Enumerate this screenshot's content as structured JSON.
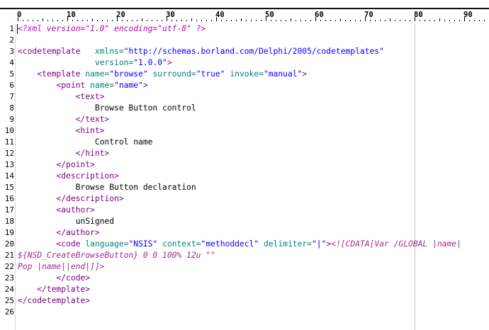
{
  "ruler": {
    "labels": [
      "0",
      "10",
      "20",
      "30",
      "40",
      "50",
      "60",
      "70",
      "80",
      "90"
    ]
  },
  "colors": {
    "tag": "#800080",
    "attribute": "#008080",
    "string": "#0000ff",
    "processing_instruction": "#c000c0",
    "cdata": "#9b308f"
  },
  "editor": {
    "lines": [
      {
        "number": "1",
        "tokens": [
          {
            "k": "pi",
            "t": "<?xml version=\"1.0\" encoding=\"utf-8\" ?>"
          }
        ]
      },
      {
        "number": "2",
        "tokens": []
      },
      {
        "number": "3",
        "tokens": [
          {
            "k": "tag",
            "t": "<codetemplate"
          },
          {
            "k": "txt",
            "t": "   "
          },
          {
            "k": "attr",
            "t": "xmlns="
          },
          {
            "k": "str",
            "t": "\"http://schemas.borland.com/Delphi/2005/codetemplates\""
          }
        ]
      },
      {
        "number": "4",
        "tokens": [
          {
            "k": "txt",
            "t": "                "
          },
          {
            "k": "attr",
            "t": "version="
          },
          {
            "k": "str",
            "t": "\"1.0.0\""
          },
          {
            "k": "tag",
            "t": ">"
          }
        ]
      },
      {
        "number": "5",
        "tokens": [
          {
            "k": "txt",
            "t": "    "
          },
          {
            "k": "tag",
            "t": "<template"
          },
          {
            "k": "txt",
            "t": " "
          },
          {
            "k": "attr",
            "t": "name="
          },
          {
            "k": "str",
            "t": "\"browse\""
          },
          {
            "k": "txt",
            "t": " "
          },
          {
            "k": "attr",
            "t": "surround="
          },
          {
            "k": "str",
            "t": "\"true\""
          },
          {
            "k": "txt",
            "t": " "
          },
          {
            "k": "attr",
            "t": "invoke="
          },
          {
            "k": "str",
            "t": "\"manual\""
          },
          {
            "k": "tag",
            "t": ">"
          }
        ]
      },
      {
        "number": "6",
        "tokens": [
          {
            "k": "txt",
            "t": "        "
          },
          {
            "k": "tag",
            "t": "<point"
          },
          {
            "k": "txt",
            "t": " "
          },
          {
            "k": "attr",
            "t": "name="
          },
          {
            "k": "str",
            "t": "\"name\""
          },
          {
            "k": "tag",
            "t": ">"
          }
        ]
      },
      {
        "number": "7",
        "tokens": [
          {
            "k": "txt",
            "t": "            "
          },
          {
            "k": "tag",
            "t": "<text>"
          }
        ]
      },
      {
        "number": "8",
        "tokens": [
          {
            "k": "txt",
            "t": "                Browse Button control"
          }
        ]
      },
      {
        "number": "9",
        "tokens": [
          {
            "k": "txt",
            "t": "            "
          },
          {
            "k": "tag",
            "t": "</text>"
          }
        ]
      },
      {
        "number": "10",
        "tokens": [
          {
            "k": "txt",
            "t": "            "
          },
          {
            "k": "tag",
            "t": "<hint>"
          }
        ]
      },
      {
        "number": "11",
        "tokens": [
          {
            "k": "txt",
            "t": "                Control name"
          }
        ]
      },
      {
        "number": "12",
        "tokens": [
          {
            "k": "txt",
            "t": "            "
          },
          {
            "k": "tag",
            "t": "</hint>"
          }
        ]
      },
      {
        "number": "13",
        "tokens": [
          {
            "k": "txt",
            "t": "        "
          },
          {
            "k": "tag",
            "t": "</point>"
          }
        ]
      },
      {
        "number": "14",
        "tokens": [
          {
            "k": "txt",
            "t": "        "
          },
          {
            "k": "tag",
            "t": "<description>"
          }
        ]
      },
      {
        "number": "15",
        "tokens": [
          {
            "k": "txt",
            "t": "            Browse Button declaration"
          }
        ]
      },
      {
        "number": "16",
        "tokens": [
          {
            "k": "txt",
            "t": "        "
          },
          {
            "k": "tag",
            "t": "</description>"
          }
        ]
      },
      {
        "number": "17",
        "tokens": [
          {
            "k": "txt",
            "t": "        "
          },
          {
            "k": "tag",
            "t": "<author>"
          }
        ]
      },
      {
        "number": "18",
        "tokens": [
          {
            "k": "txt",
            "t": "            unSigned"
          }
        ]
      },
      {
        "number": "19",
        "tokens": [
          {
            "k": "txt",
            "t": "        "
          },
          {
            "k": "tag",
            "t": "</author>"
          }
        ]
      },
      {
        "number": "20",
        "tokens": [
          {
            "k": "txt",
            "t": "        "
          },
          {
            "k": "tag",
            "t": "<code"
          },
          {
            "k": "txt",
            "t": " "
          },
          {
            "k": "attr",
            "t": "language="
          },
          {
            "k": "str",
            "t": "\"NSIS\""
          },
          {
            "k": "txt",
            "t": " "
          },
          {
            "k": "attr",
            "t": "context="
          },
          {
            "k": "str",
            "t": "\"methoddecl\""
          },
          {
            "k": "txt",
            "t": " "
          },
          {
            "k": "attr",
            "t": "delimiter="
          },
          {
            "k": "str",
            "t": "\"|\""
          },
          {
            "k": "tag",
            "t": ">"
          },
          {
            "k": "cdata",
            "t": "<![CDATA[Var /GLOBAL |name|"
          }
        ]
      },
      {
        "number": "21",
        "tokens": [
          {
            "k": "cdata",
            "t": "${NSD_CreateBrowseButton} 0 0 100% 12u \"\""
          }
        ]
      },
      {
        "number": "22",
        "tokens": [
          {
            "k": "cdata",
            "t": "Pop |name||end|]]>"
          }
        ]
      },
      {
        "number": "23",
        "tokens": [
          {
            "k": "txt",
            "t": "        "
          },
          {
            "k": "tag",
            "t": "</code>"
          }
        ]
      },
      {
        "number": "24",
        "tokens": [
          {
            "k": "txt",
            "t": "    "
          },
          {
            "k": "tag",
            "t": "</template>"
          }
        ]
      },
      {
        "number": "25",
        "tokens": [
          {
            "k": "tag",
            "t": "</codetemplate>"
          }
        ]
      },
      {
        "number": "26",
        "tokens": []
      }
    ]
  }
}
